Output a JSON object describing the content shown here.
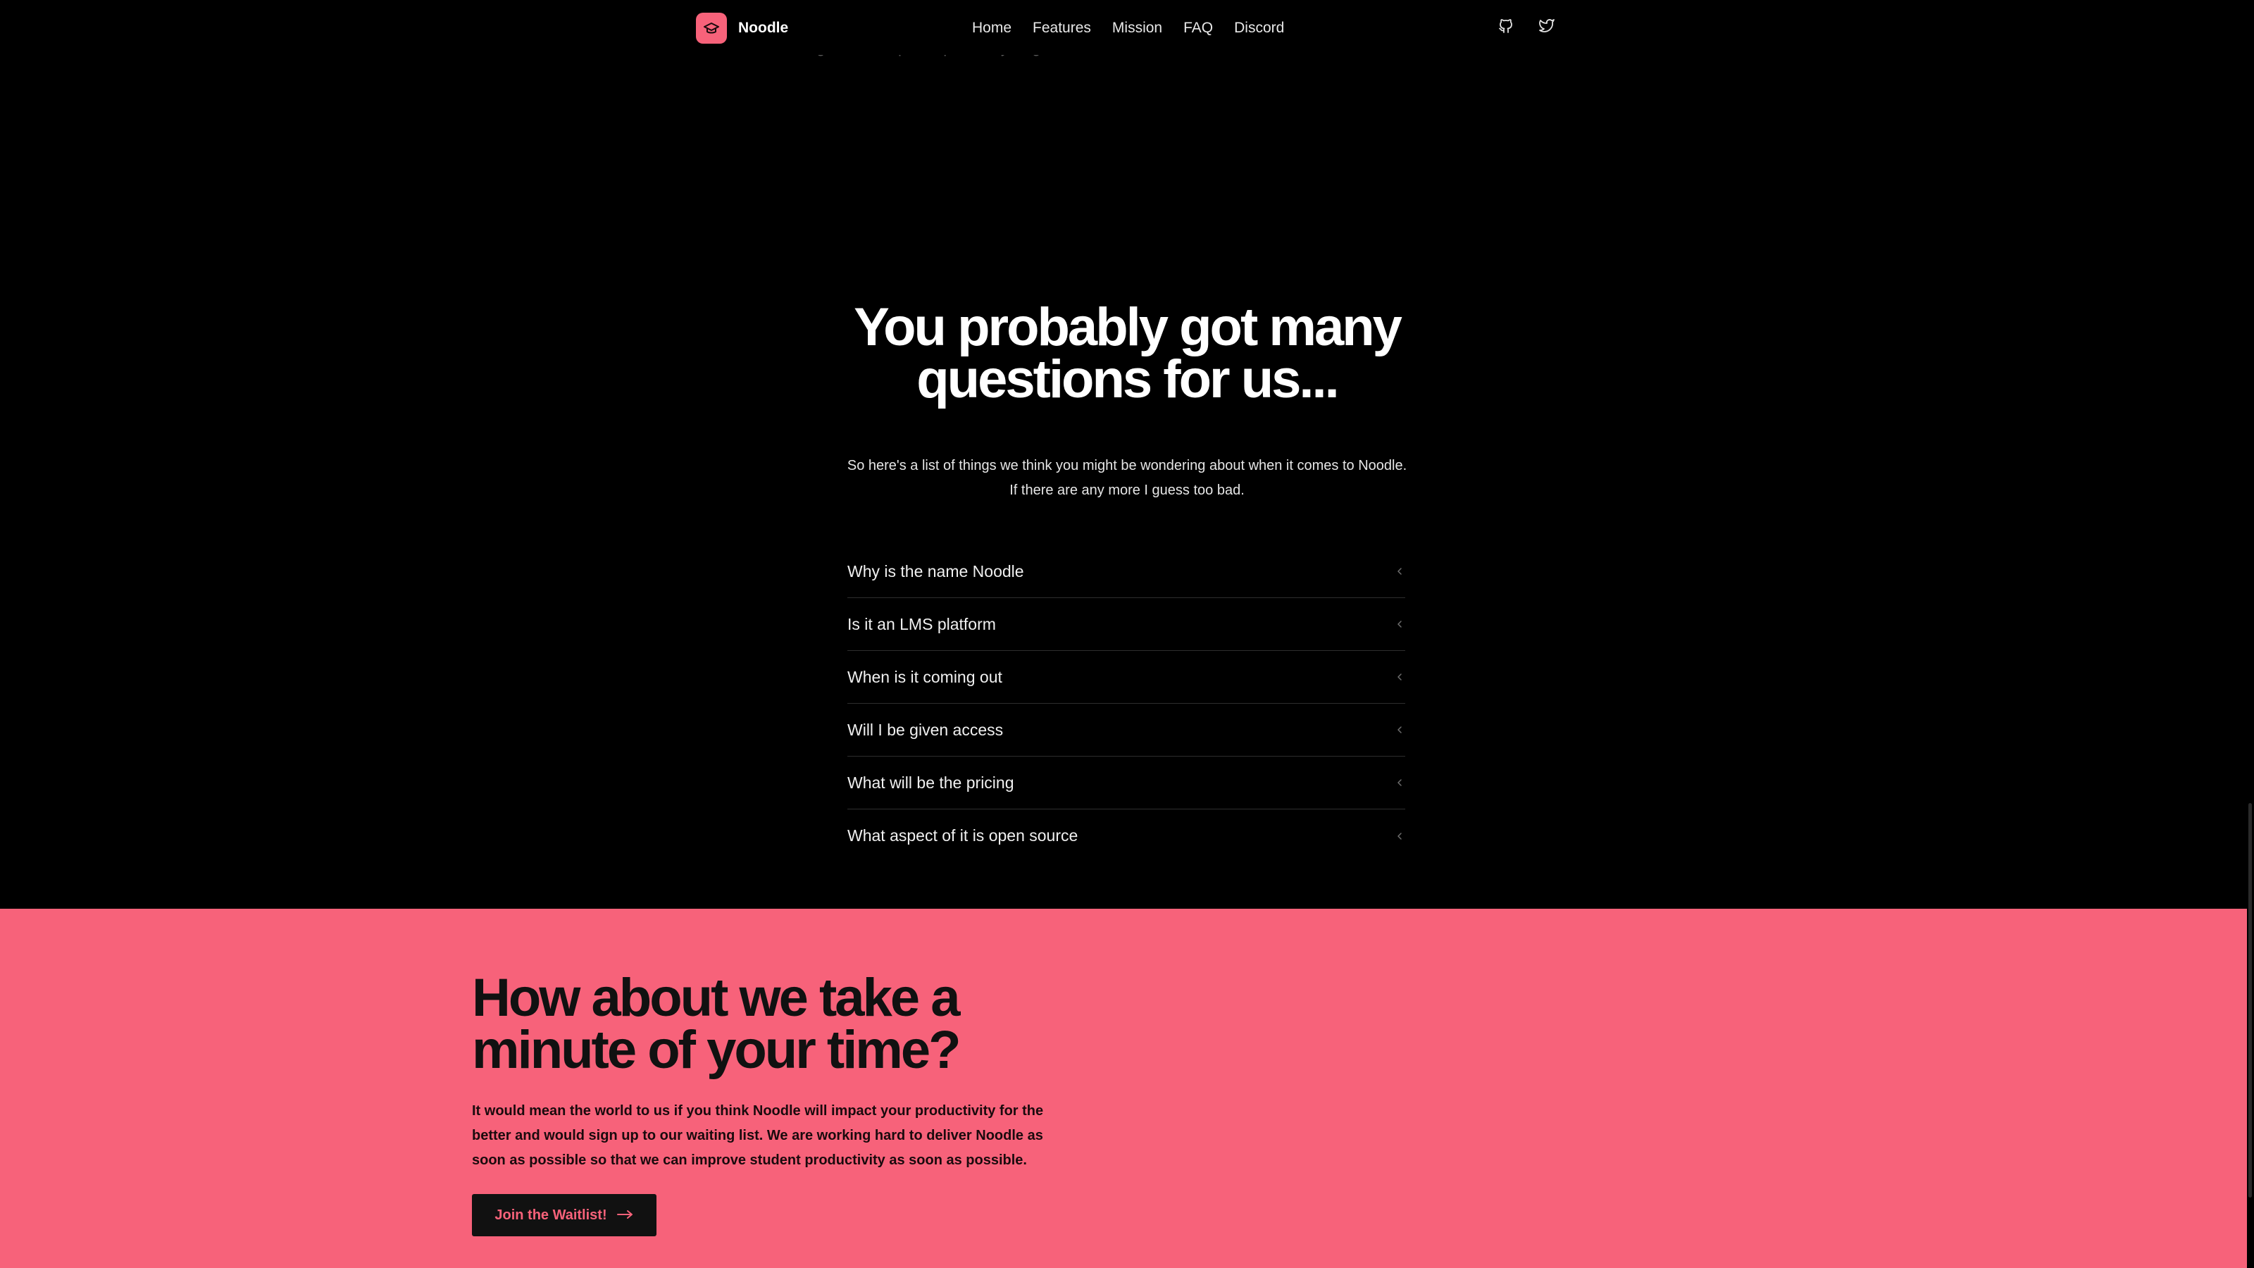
{
  "nav": {
    "brand": "Noodle",
    "links": [
      "Home",
      "Features",
      "Mission",
      "FAQ",
      "Discord"
    ],
    "icons": [
      "github-icon",
      "twitter-icon"
    ]
  },
  "intro": {
    "tail": "our degrees to keep on top of everything."
  },
  "faq": {
    "title": "You probably got many questions for us...",
    "subtitle": "So here's a list of things we think you might be wondering about when it comes to Noodle. If there are any more I guess too bad.",
    "questions": [
      "Why is the name Noodle",
      "Is it an LMS platform",
      "When is it coming out",
      "Will I be given access",
      "What will be the pricing",
      "What aspect of it is open source"
    ]
  },
  "cta": {
    "title": "How about we take a minute of your time?",
    "text": "It would mean the world to us if you think Noodle will impact your productivity for the better and would sign up to our waiting list. We are working hard to deliver Noodle as soon as possible so that we can improve student productivity as soon as possible.",
    "button": "Join the Waitlist!"
  },
  "colors": {
    "accent": "#f7627a",
    "background": "#000000",
    "dark": "#111111"
  }
}
